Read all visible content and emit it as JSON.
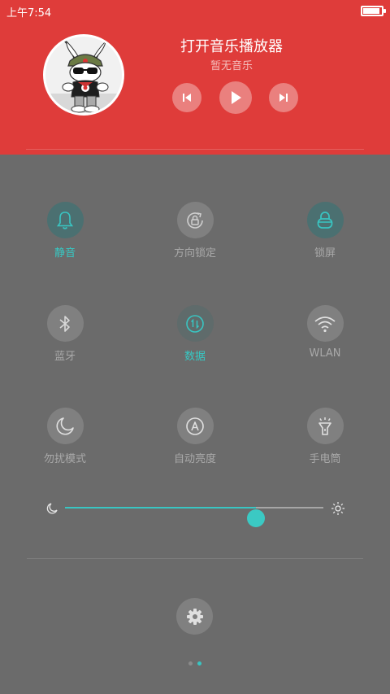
{
  "status_bar": {
    "time": "上午7:54",
    "battery_level": 0.9,
    "battery_icon": "battery-icon"
  },
  "music": {
    "title": "打开音乐播放器",
    "subtitle": "暂无音乐",
    "avatar_icon": "mitu-bunny-avatar",
    "controls": [
      "previous-icon",
      "play-icon",
      "next-icon"
    ]
  },
  "toggles": [
    {
      "label": "静音",
      "icon": "bell-icon",
      "active": true
    },
    {
      "label": "方向锁定",
      "icon": "rotation-lock-icon",
      "active": false
    },
    {
      "label": "锁屏",
      "icon": "lock-icon",
      "active": true
    },
    {
      "label": "蓝牙",
      "icon": "bluetooth-icon",
      "active": false
    },
    {
      "label": "数据",
      "icon": "mobile-data-icon",
      "active": true
    },
    {
      "label": "WLAN",
      "icon": "wifi-icon",
      "active": false
    },
    {
      "label": "勿扰模式",
      "icon": "moon-icon",
      "active": false
    },
    {
      "label": "自动亮度",
      "icon": "auto-brightness-icon",
      "active": false
    },
    {
      "label": "手电筒",
      "icon": "flashlight-icon",
      "active": false
    }
  ],
  "brightness": {
    "level": 0.74,
    "min_icon": "moon-small-icon",
    "max_icon": "sun-small-icon"
  },
  "settings_icon": "gear-icon",
  "pagination": {
    "count": 2,
    "active": 2
  },
  "colors": {
    "header_bg": "#df3c3a",
    "panel_bg": "#6b6b6b",
    "accent": "#39c5c2",
    "inactive_label": "#a9a9a9"
  }
}
